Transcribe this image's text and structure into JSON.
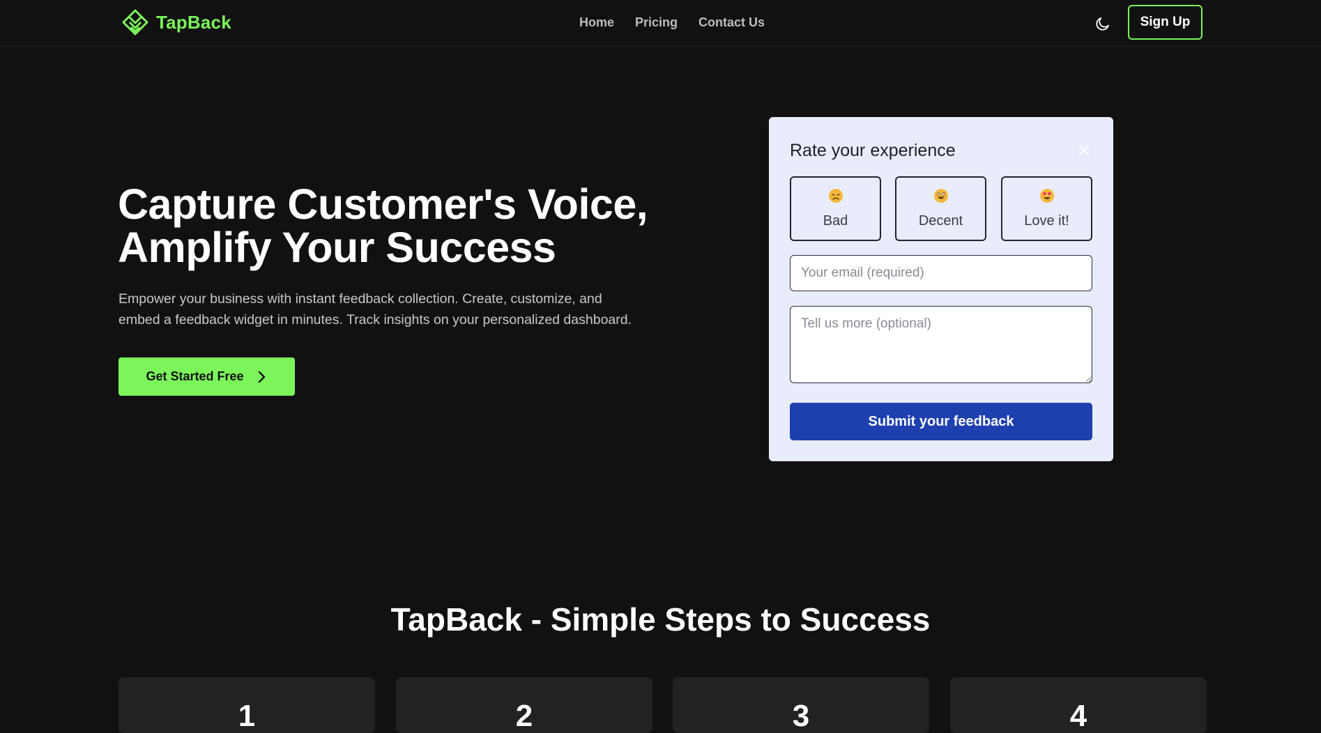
{
  "header": {
    "brand": "TapBack",
    "nav": [
      {
        "label": "Home"
      },
      {
        "label": "Pricing"
      },
      {
        "label": "Contact Us"
      }
    ],
    "signup_label": "Sign Up",
    "theme_icon": "moon-icon",
    "accent_color": "#7cf55a"
  },
  "hero": {
    "title_line1": "Capture Customer's Voice,",
    "title_line2": "Amplify Your Success",
    "subtitle_line1": "Empower your business with instant feedback collection. Create, customize, and",
    "subtitle_line2": "embed a feedback widget in minutes. Track insights on your personalized dashboard.",
    "cta_label": "Get Started Free"
  },
  "widget": {
    "title": "Rate your experience",
    "ratings": [
      {
        "label": "Bad",
        "icon": "sad-face-icon"
      },
      {
        "label": "Decent",
        "icon": "grinning-face-icon"
      },
      {
        "label": "Love it!",
        "icon": "heart-eyes-face-icon"
      }
    ],
    "email_placeholder": "Your email (required)",
    "email_value": "",
    "more_placeholder": "Tell us more (optional)",
    "more_value": "",
    "submit_label": "Submit your feedback",
    "submit_color": "#1e40af"
  },
  "steps": {
    "title": "TapBack - Simple Steps to Success",
    "cards": [
      {
        "number": "1"
      },
      {
        "number": "2"
      },
      {
        "number": "3"
      },
      {
        "number": "4"
      }
    ]
  }
}
